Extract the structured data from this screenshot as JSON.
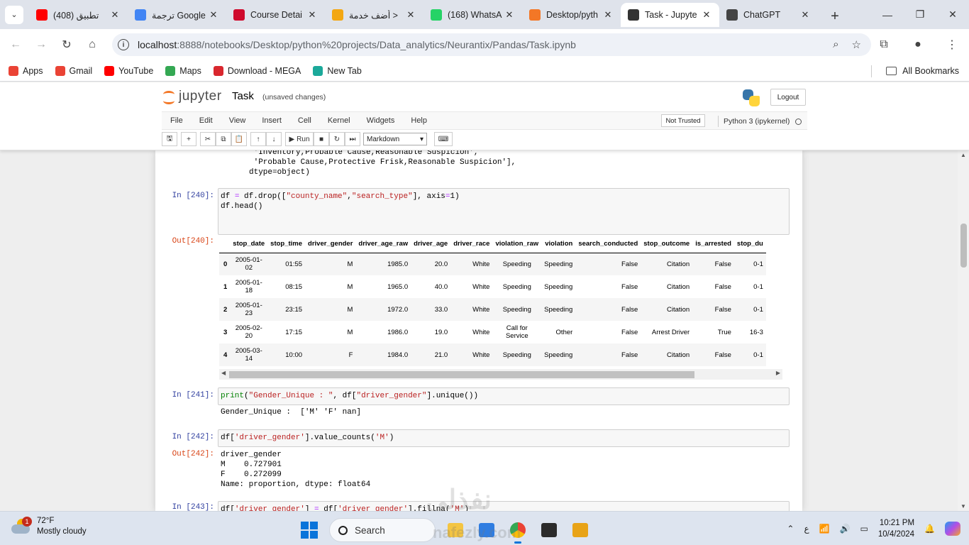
{
  "browser": {
    "tabs": [
      {
        "title": "(408) تطبيق",
        "favicon": "youtube-icon",
        "color": "#ff0000",
        "active": false
      },
      {
        "title": "ترجمة Google",
        "favicon": "google-translate-icon",
        "color": "#4285f4",
        "active": false
      },
      {
        "title": "Course Detai",
        "favicon": "huawei-icon",
        "color": "#cf0a2c",
        "active": false
      },
      {
        "title": "أضف خدمة >",
        "favicon": "khamsat-icon",
        "color": "#f3a712",
        "active": false
      },
      {
        "title": "(168) WhatsA",
        "favicon": "whatsapp-icon",
        "color": "#25d366",
        "active": false
      },
      {
        "title": "Desktop/pyth",
        "favicon": "jupyter-icon",
        "color": "#f37726",
        "active": false
      },
      {
        "title": "Task - Jupyte",
        "favicon": "notebook-icon",
        "color": "#333333",
        "active": true
      },
      {
        "title": "ChatGPT",
        "favicon": "chatgpt-icon",
        "color": "#444444",
        "active": false
      }
    ],
    "url_host": "localhost",
    "url_rest": ":8888/notebooks/Desktop/python%20projects/Data_analytics/Neurantix/Pandas/Task.ipynb",
    "bookmarks": [
      {
        "label": "Apps",
        "icon": "apps-grid-icon",
        "color": "#ea4335"
      },
      {
        "label": "Gmail",
        "icon": "gmail-icon",
        "color": "#ea4335"
      },
      {
        "label": "YouTube",
        "icon": "youtube-icon",
        "color": "#ff0000"
      },
      {
        "label": "Maps",
        "icon": "maps-pin-icon",
        "color": "#34a853"
      },
      {
        "label": "Download - MEGA",
        "icon": "mega-icon",
        "color": "#d9272e"
      },
      {
        "label": "New Tab",
        "icon": "new-tab-icon",
        "color": "#1ba99a"
      }
    ],
    "all_bookmarks": "All Bookmarks"
  },
  "jupyter": {
    "logo_text": "jupyter",
    "notebook_name": "Task",
    "save_status": "(unsaved changes)",
    "logout": "Logout",
    "menu": [
      "File",
      "Edit",
      "View",
      "Insert",
      "Cell",
      "Kernel",
      "Widgets",
      "Help"
    ],
    "trust": "Not Trusted",
    "kernel": "Python 3 (ipykernel)",
    "run_label": "Run",
    "cell_type": "Markdown"
  },
  "cells": {
    "prev_output": " 'Inventory,Probable Cause,Reasonable Suspicion',\n 'Probable Cause,Protective Frisk,Reasonable Suspicion'],\ndtype=object)",
    "c240_in": "In [240]:",
    "c240_out": "Out[240]:",
    "c241_in": "In [241]:",
    "c241_output": "Gender_Unique :  ['M' 'F' nan]",
    "c242_in": "In [242]:",
    "c242_out": "Out[242]:",
    "c242_output": "driver_gender\nM    0.727901\nF    0.272099\nName: proportion, dtype: float64",
    "c243_in": "In [243]:"
  },
  "dataframe": {
    "columns": [
      "",
      "stop_date",
      "stop_time",
      "driver_gender",
      "driver_age_raw",
      "driver_age",
      "driver_race",
      "violation_raw",
      "violation",
      "search_conducted",
      "stop_outcome",
      "is_arrested",
      "stop_du"
    ],
    "rows": [
      [
        "0",
        "2005-01-02",
        "01:55",
        "M",
        "1985.0",
        "20.0",
        "White",
        "Speeding",
        "Speeding",
        "False",
        "Citation",
        "False",
        "0-1"
      ],
      [
        "1",
        "2005-01-18",
        "08:15",
        "M",
        "1965.0",
        "40.0",
        "White",
        "Speeding",
        "Speeding",
        "False",
        "Citation",
        "False",
        "0-1"
      ],
      [
        "2",
        "2005-01-23",
        "23:15",
        "M",
        "1972.0",
        "33.0",
        "White",
        "Speeding",
        "Speeding",
        "False",
        "Citation",
        "False",
        "0-1"
      ],
      [
        "3",
        "2005-02-20",
        "17:15",
        "M",
        "1986.0",
        "19.0",
        "White",
        "Call for Service",
        "Other",
        "False",
        "Arrest Driver",
        "True",
        "16-3"
      ],
      [
        "4",
        "2005-03-14",
        "10:00",
        "F",
        "1984.0",
        "21.0",
        "White",
        "Speeding",
        "Speeding",
        "False",
        "Citation",
        "False",
        "0-1"
      ]
    ]
  },
  "watermark": {
    "arabic": "نفذلي",
    "latin": "nafezly.com"
  },
  "taskbar": {
    "weather_temp": "72°F",
    "weather_desc": "Mostly cloudy",
    "weather_badge": "1",
    "search": "Search",
    "lang": "ع",
    "time": "10:21 PM",
    "date": "10/4/2024"
  }
}
